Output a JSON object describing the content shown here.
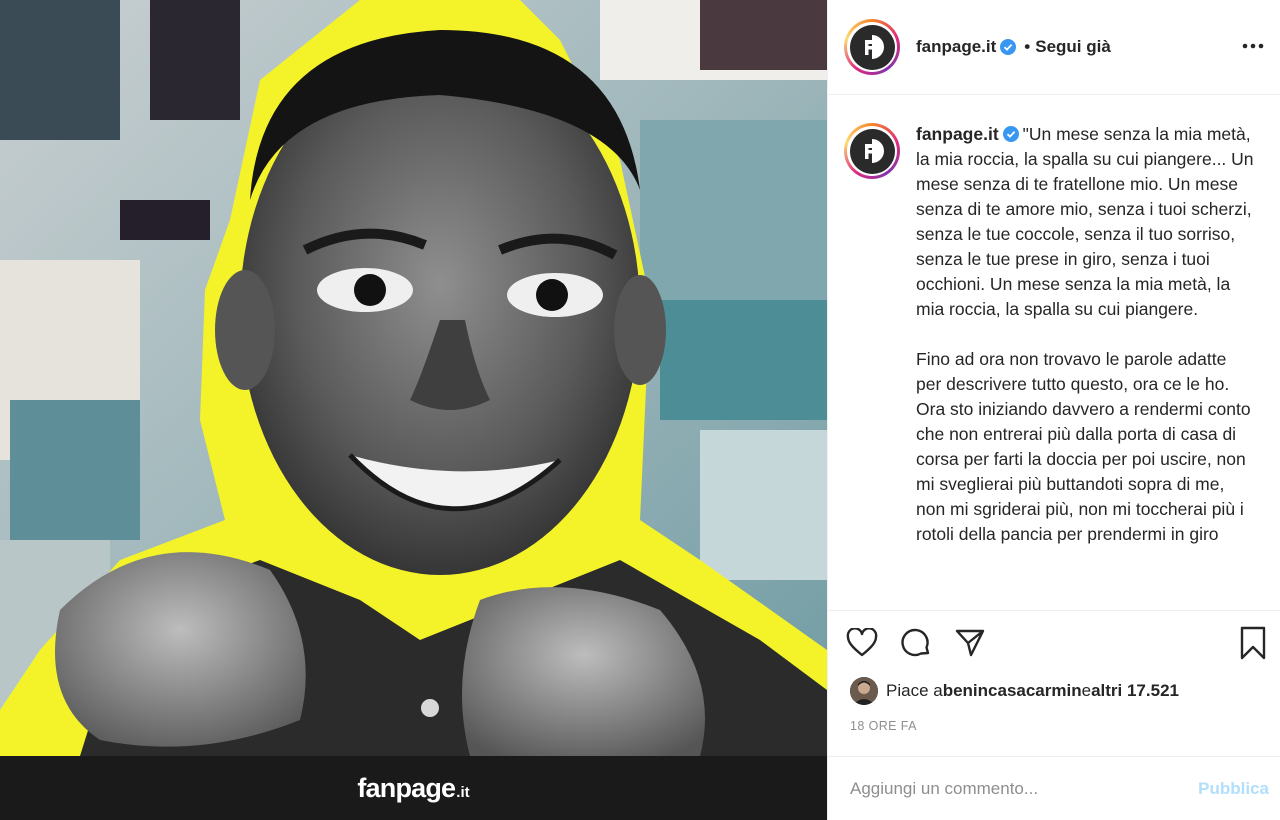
{
  "media": {
    "watermark_main": "fanpage",
    "watermark_suffix": ".it"
  },
  "header": {
    "username": "fanpage.it",
    "separator": "•",
    "follow_label": "Segui già",
    "more_icon": "more-horizontal-icon"
  },
  "caption": {
    "username": "fanpage.it",
    "text": "\"Un mese senza la mia metà, la mia roccia, la spalla su cui piangere... Un mese senza di te fratellone mio. Un mese senza di te amore mio, senza i tuoi scherzi, senza le tue coccole, senza il tuo sorriso, senza le tue prese in giro, senza i tuoi occhioni. Un mese senza la mia metà, la mia roccia, la spalla su cui piangere.\n\nFino ad ora non trovavo le parole adatte per descrivere tutto questo, ora ce le ho. Ora sto iniziando davvero a rendermi conto che non entrerai più dalla porta di casa di corsa per farti la doccia per poi uscire, non mi sveglierai più buttandoti sopra di me, non mi sgriderai più, non mi toccherai più i rotoli della pancia per prendermi in giro"
  },
  "actions": {
    "like_icon": "heart-icon",
    "comment_icon": "comment-icon",
    "share_icon": "share-icon",
    "save_icon": "bookmark-icon"
  },
  "likes": {
    "prefix": "Piace a ",
    "user": "benincasacarmin",
    "conjunction": " e ",
    "others": "altri 17.521"
  },
  "timestamp": "18 ORE FA",
  "comment": {
    "placeholder": "Aggiungi un commento...",
    "publish_label": "Pubblica"
  },
  "colors": {
    "verified": "#3897f0",
    "publish_disabled": "#b2dffc",
    "accent_yellow": "#f4f32a"
  }
}
